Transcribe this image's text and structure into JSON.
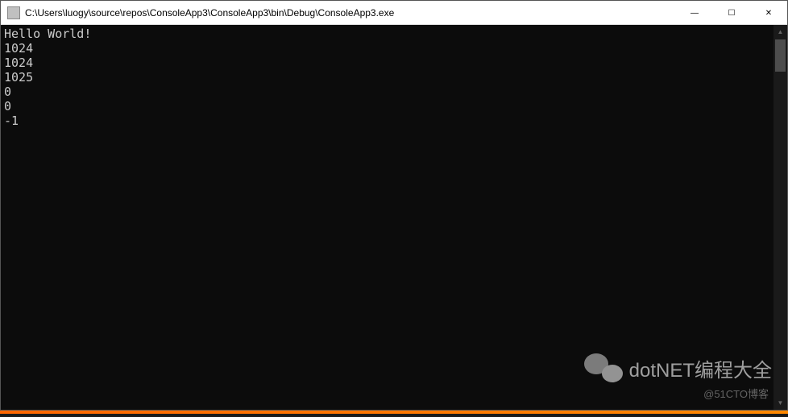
{
  "titlebar": {
    "path": "C:\\Users\\luogy\\source\\repos\\ConsoleApp3\\ConsoleApp3\\bin\\Debug\\ConsoleApp3.exe"
  },
  "window_controls": {
    "minimize": "—",
    "maximize": "☐",
    "close": "✕"
  },
  "console": {
    "lines": [
      "Hello World!",
      "1024",
      "1024",
      "1025",
      "0",
      "0",
      "-1"
    ]
  },
  "scrollbar": {
    "up": "▲",
    "down": "▼"
  },
  "watermark": {
    "text": "dotNET编程大全",
    "sub": "@51CTO博客"
  }
}
